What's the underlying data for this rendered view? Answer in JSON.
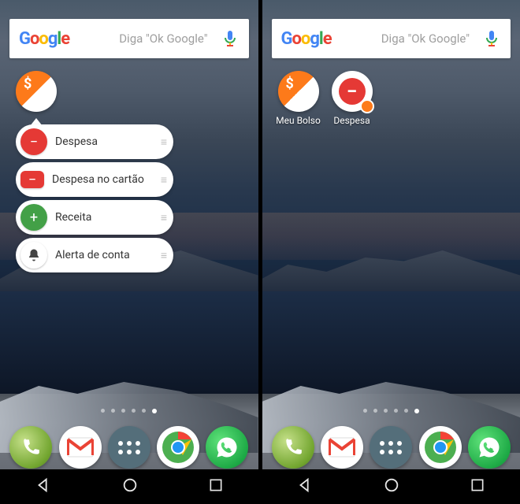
{
  "search": {
    "logo": "Google",
    "placeholder": "Diga \"Ok Google\""
  },
  "left": {
    "app_icon": "meubolso",
    "popup": [
      {
        "label": "Despesa",
        "icon": "minus-circle",
        "color": "#e53935",
        "glyph": "−"
      },
      {
        "label": "Despesa no cartão",
        "icon": "card-minus",
        "color": "#e53935",
        "glyph": "▬"
      },
      {
        "label": "Receita",
        "icon": "plus-circle",
        "color": "#43a047",
        "glyph": "+"
      },
      {
        "label": "Alerta de conta",
        "icon": "bell",
        "color": "#ffffff",
        "glyph": "🔔"
      }
    ]
  },
  "right": {
    "icons": [
      {
        "label": "Meu Bolso",
        "type": "meubolso"
      },
      {
        "label": "Despesa",
        "type": "despesa"
      }
    ]
  },
  "dots": {
    "count": 6,
    "active": 5
  },
  "dock": [
    {
      "name": "phone-icon"
    },
    {
      "name": "gmail-icon"
    },
    {
      "name": "apps-icon"
    },
    {
      "name": "chrome-icon"
    },
    {
      "name": "whatsapp-icon"
    }
  ],
  "nav": [
    "back",
    "home",
    "recent"
  ]
}
